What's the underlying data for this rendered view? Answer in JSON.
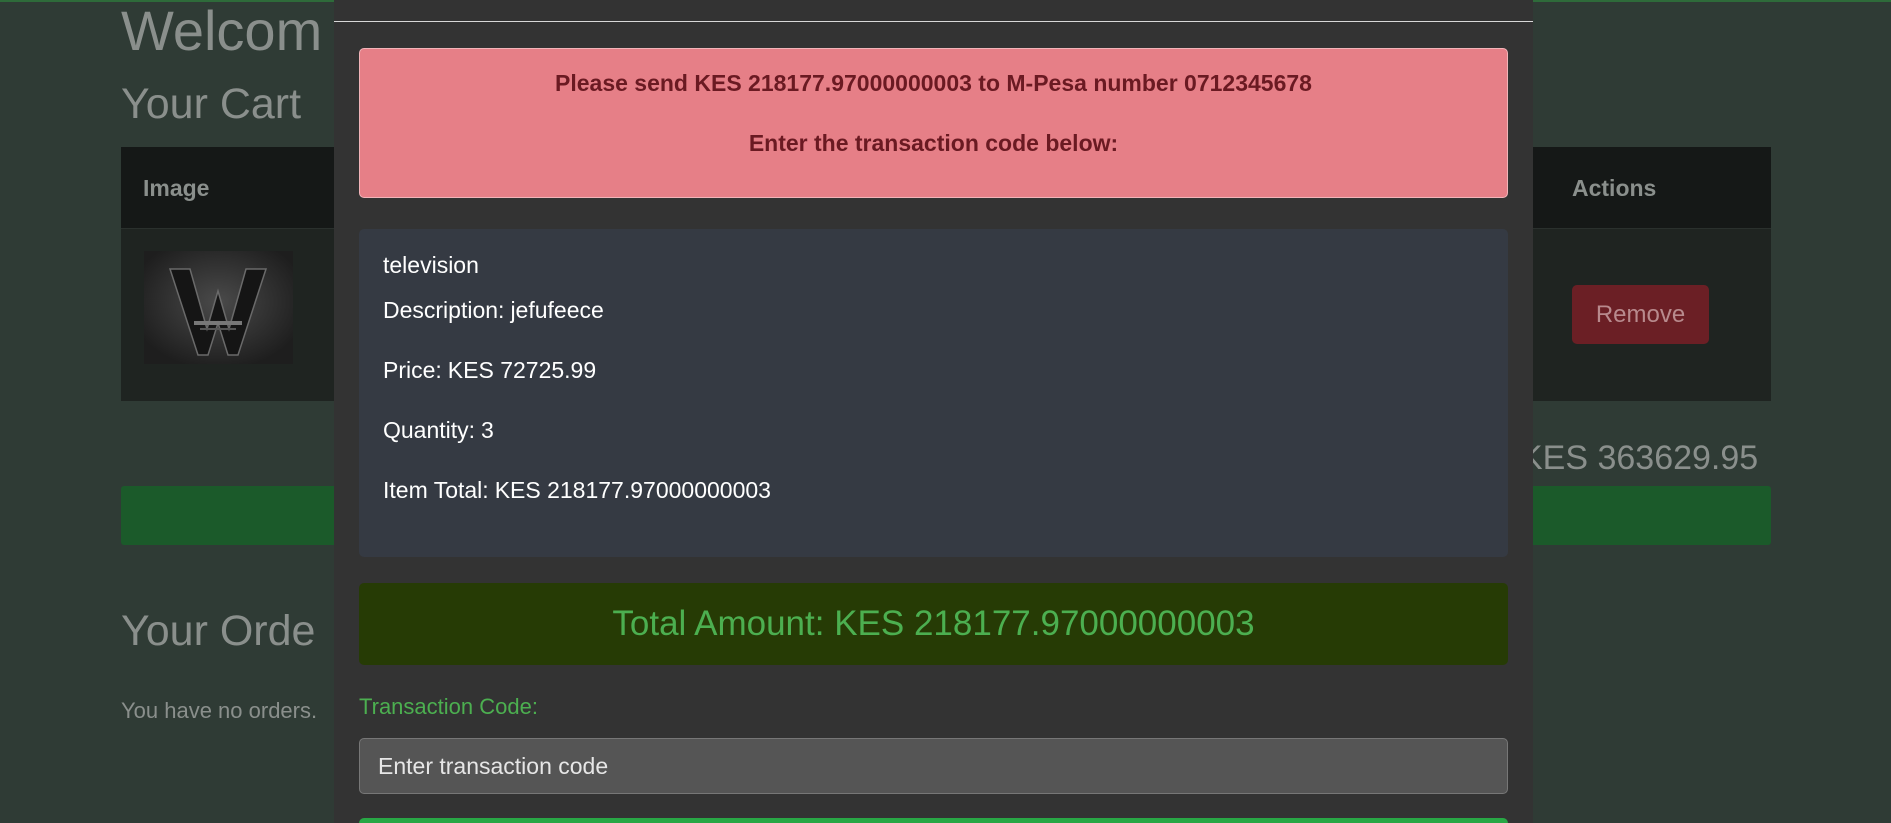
{
  "background": {
    "welcome_heading": "Welcom",
    "cart_heading": "Your Cart",
    "table_headers": {
      "image": "Image",
      "actions": "Actions"
    },
    "remove_label": "Remove",
    "cart_total": "KES 363629.95",
    "orders_heading": "Your Orde",
    "no_orders_text": "You have no orders."
  },
  "modal": {
    "alert": {
      "line1": "Please send KES 218177.97000000003 to M-Pesa number 0712345678",
      "line2": "Enter the transaction code below:"
    },
    "item": {
      "name": "television",
      "description_label": "Description:",
      "description": "jefufeece",
      "price_label": "Price:",
      "price": "KES 72725.99",
      "quantity_label": "Quantity:",
      "quantity": "3",
      "total_label": "Item Total:",
      "total": "KES 218177.97000000003"
    },
    "total_amount": "Total Amount: KES 218177.97000000003",
    "transaction_label": "Transaction Code:",
    "transaction_placeholder": "Enter transaction code"
  },
  "colors": {
    "alert_bg": "#e67f87",
    "accent_green": "#4caf50",
    "total_box_bg": "#263b05",
    "remove_button": "#6b1f25"
  }
}
